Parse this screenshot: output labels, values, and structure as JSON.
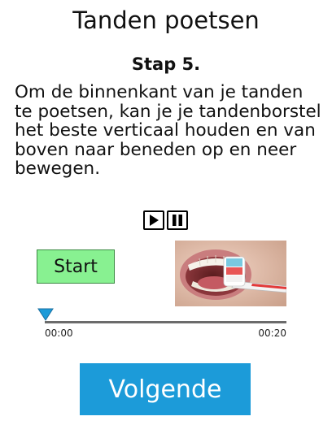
{
  "page": {
    "title": "Tanden poetsen"
  },
  "step": {
    "title": "Stap 5.",
    "instruction": "Om de binnenkant van je tanden te poetsen, kan je je tandenborstel het beste verticaal houden en van boven naar beneden op en neer bewegen."
  },
  "media": {
    "play_icon": "play-icon",
    "pause_icon": "pause-icon",
    "start_label": "Start",
    "time_start": "00:00",
    "time_end": "00:20",
    "progress": 0.0
  },
  "navigation": {
    "next_label": "Volgende"
  },
  "colors": {
    "start_button": "#88f191",
    "next_button": "#1c9bd9",
    "playhead": "#1c9bd9",
    "timeline": "#6b6b6b"
  }
}
